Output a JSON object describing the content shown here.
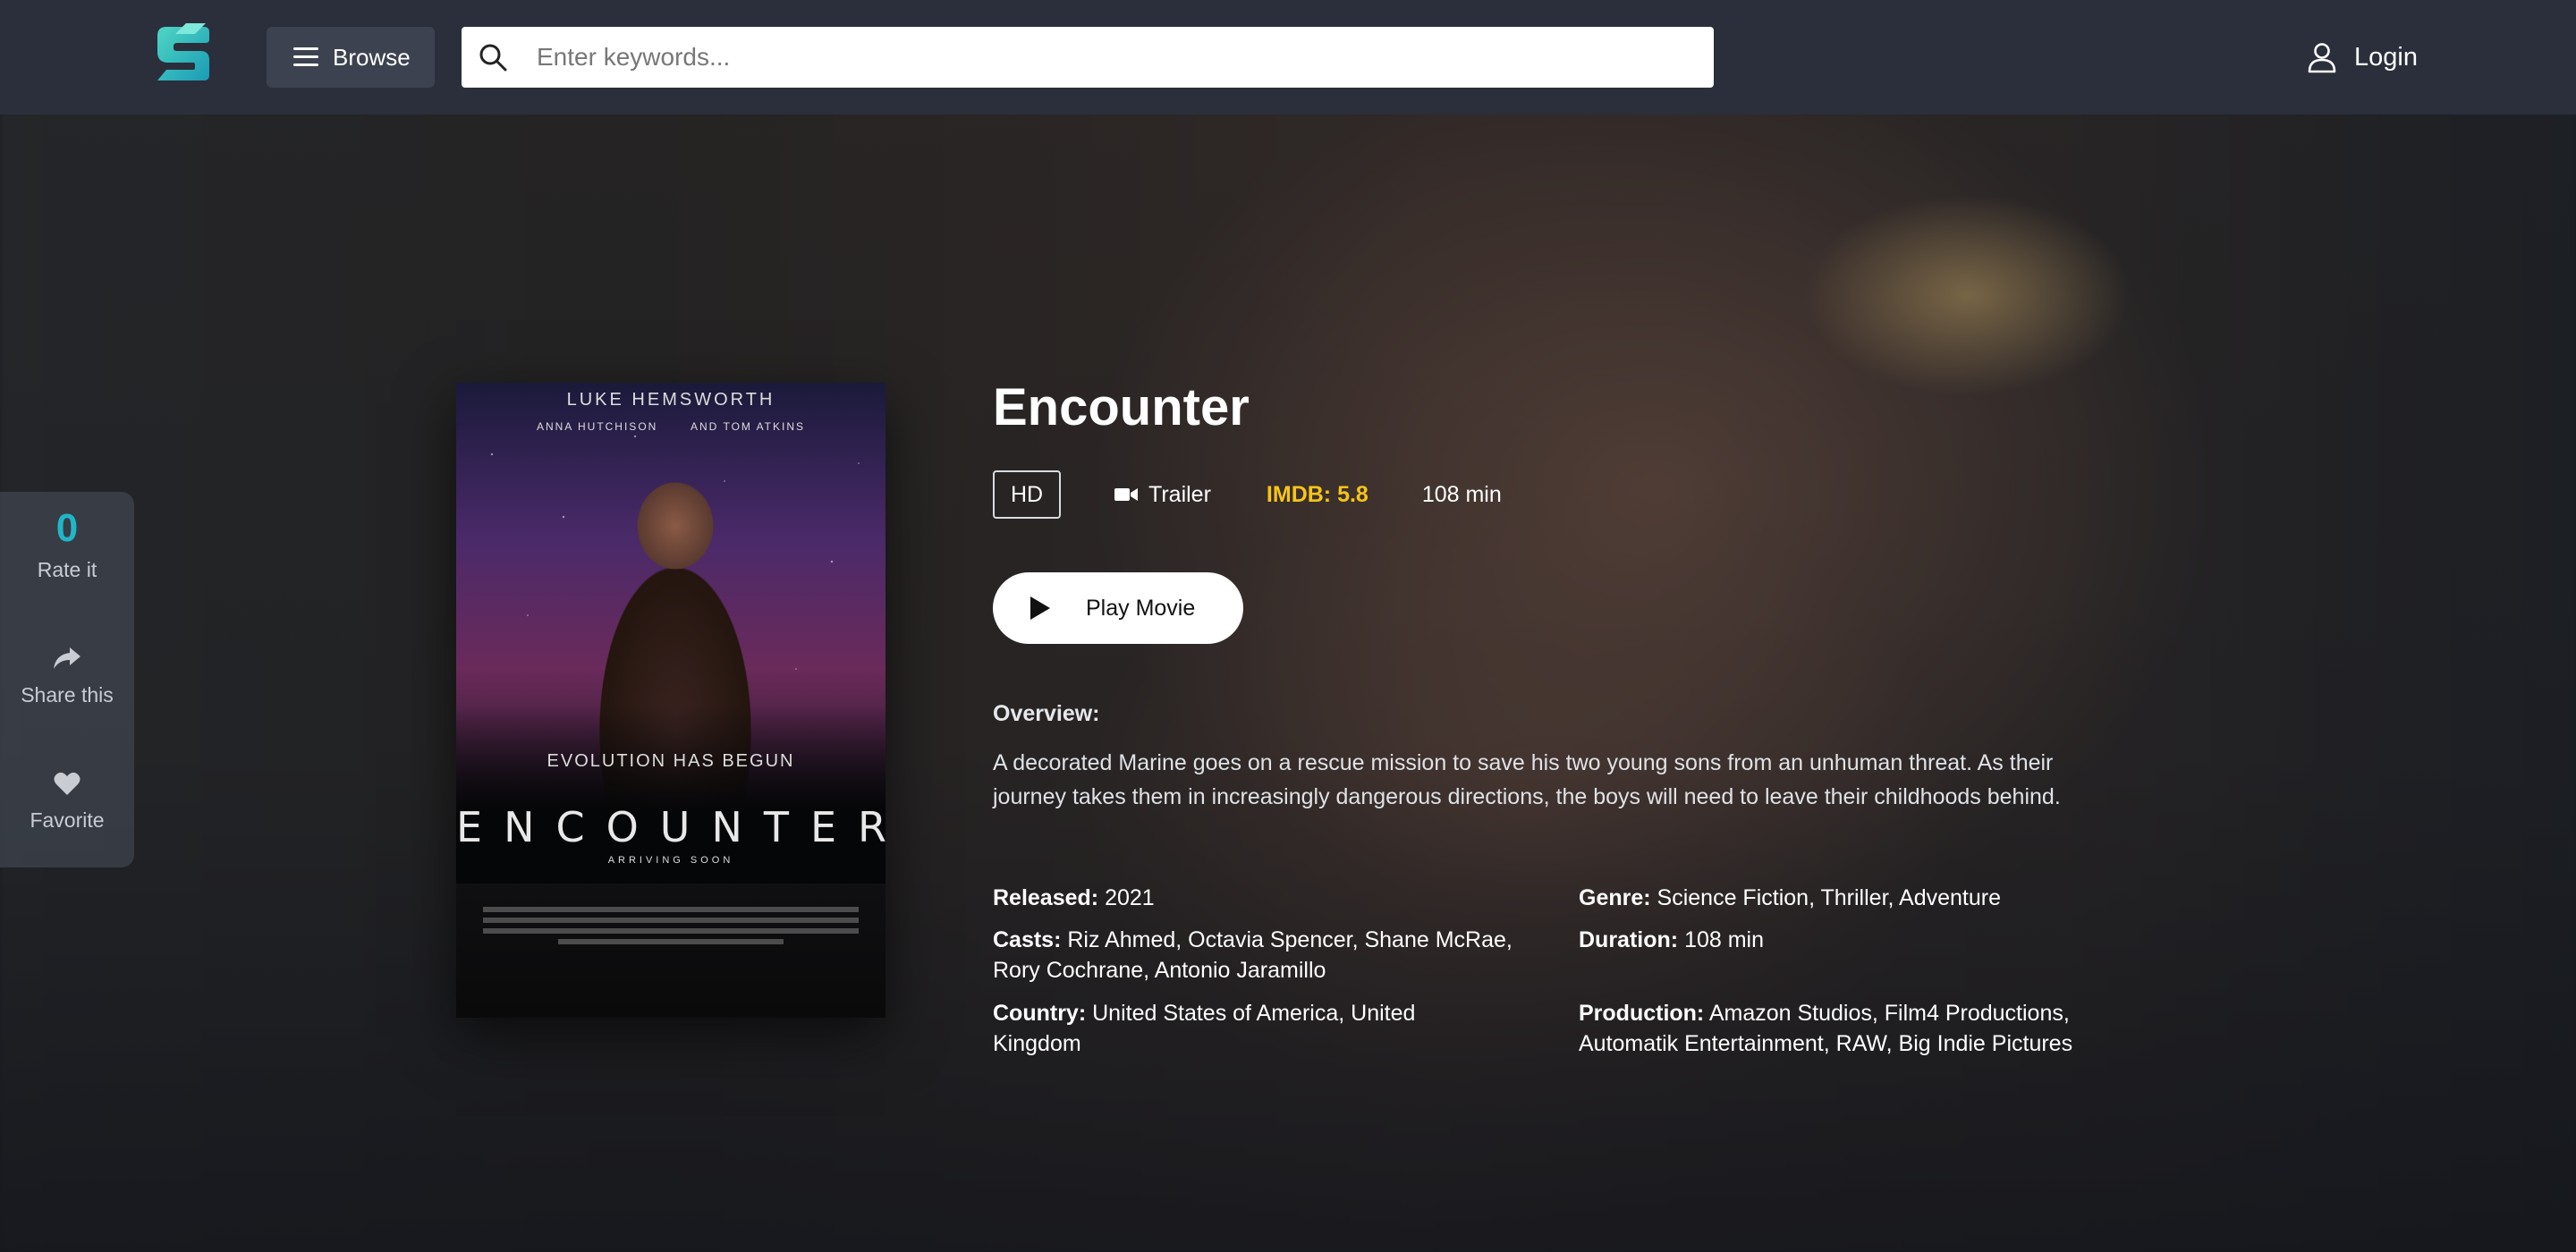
{
  "header": {
    "browse_label": "Browse",
    "search_placeholder": "Enter keywords...",
    "login_label": "Login"
  },
  "side_actions": {
    "rating_value": "0",
    "rate_label": "Rate it",
    "share_label": "Share this",
    "favorite_label": "Favorite"
  },
  "poster": {
    "actor": "LUKE HEMSWORTH",
    "costars_left": "ANNA HUTCHISON",
    "costars_and": "AND TOM ATKINS",
    "tagline": "EVOLUTION HAS BEGUN",
    "title": "ENCOUNTER",
    "subtitle": "ARRIVING SOON"
  },
  "movie": {
    "title": "Encounter",
    "quality": "HD",
    "trailer_label": "Trailer",
    "imdb": "IMDB: 5.8",
    "runtime": "108 min",
    "play_label": "Play Movie",
    "overview_label": "Overview:",
    "overview": "A decorated Marine goes on a rescue mission to save his two young sons from an unhuman threat. As their journey takes them in increasingly dangerous directions, the boys will need to leave their childhoods behind.",
    "released_label": "Released:",
    "released": "2021",
    "genre_label": "Genre:",
    "genre": "Science Fiction, Thriller, Adventure",
    "casts_label": "Casts:",
    "casts": "Riz Ahmed, Octavia Spencer, Shane McRae, Rory Cochrane, Antonio Jaramillo",
    "duration_label": "Duration:",
    "duration": "108 min",
    "country_label": "Country:",
    "country": "United States of America, United Kingdom",
    "production_label": "Production:",
    "production": "Amazon Studios, Film4 Productions, Automatik Entertainment, RAW, Big Indie Pictures"
  },
  "colors": {
    "header_bg": "#2a2f3b",
    "accent": "#1fb6c8",
    "imdb": "#f5c518"
  }
}
